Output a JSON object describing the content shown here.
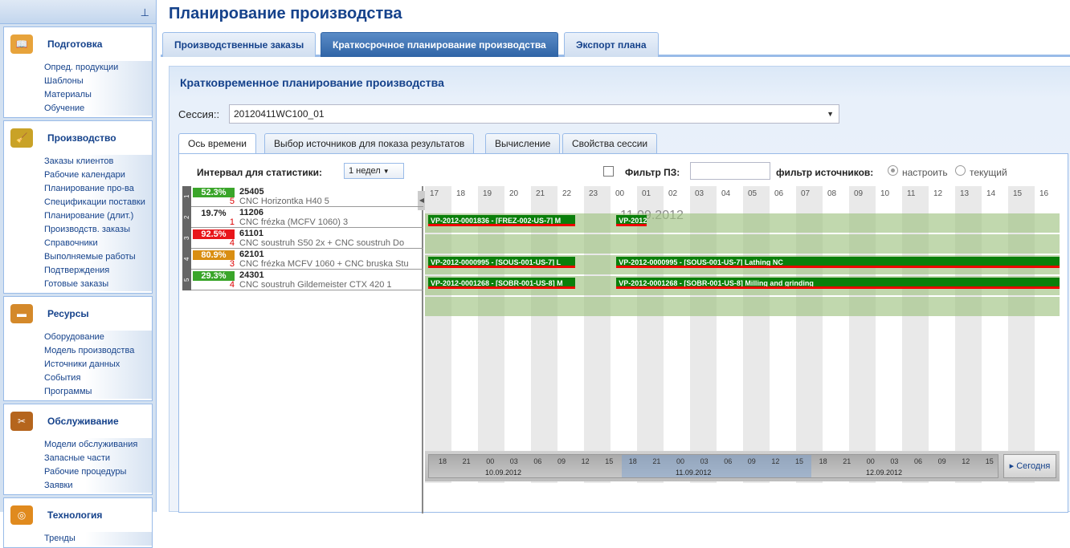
{
  "sidebar": {
    "pin_icon": "pin-icon",
    "sections": [
      {
        "title": "Подготовка",
        "icon": "book-icon",
        "color": "#e7a33b",
        "items": [
          "Опред. продукции",
          "Шаблоны",
          "Материалы",
          "Обучение"
        ]
      },
      {
        "title": "Производство",
        "icon": "broom-icon",
        "color": "#c9a227",
        "items": [
          "Заказы клиентов",
          "Рабочие календари",
          "Планирование про-ва",
          "Спецификации поставки",
          "Планирование (длит.)",
          "Производств. заказы",
          "Справочники",
          "Выполняемые работы",
          "Подтверждения",
          "Готовые заказы"
        ]
      },
      {
        "title": "Ресурсы",
        "icon": "machine-icon",
        "color": "#d4892a",
        "items": [
          "Оборудование",
          "Модель производства",
          "Источники данных",
          "События",
          "Программы"
        ]
      },
      {
        "title": "Обслуживание",
        "icon": "tools-icon",
        "color": "#b5651d",
        "items": [
          "Модели обслуживания",
          "Запасные части",
          "Рабочие процедуры",
          "Заявки"
        ]
      },
      {
        "title": "Технология",
        "icon": "gauge-icon",
        "color": "#e08a1e",
        "items": [
          "Тренды"
        ]
      }
    ]
  },
  "page_title": "Планирование производства",
  "top_tabs": [
    "Производственные заказы",
    "Краткосрочное планирование производства",
    "Экспорт плана"
  ],
  "panel_title": "Кратковременное планирование производства",
  "session": {
    "label": "Сессия::",
    "value": "20120411WC100_01"
  },
  "sub_tabs": [
    "Ось времени",
    "Выбор источников для показа результатов",
    "Вычисление",
    "Свойства сессии"
  ],
  "filters": {
    "interval_label": "Интервал для статистики:",
    "interval_value": "1 недел",
    "fpz_label": "Фильтр ПЗ:",
    "fpz_value": "",
    "source_label": "фильтр источников:",
    "radio_configure": "настроить",
    "radio_current": "текущий"
  },
  "resources": [
    {
      "num": "1",
      "pct": "52.3%",
      "pct_color": "#3aa52a",
      "id": "25405",
      "count": "5",
      "name": "CNC Horizontka H40 5"
    },
    {
      "num": "2",
      "pct": "19.7%",
      "pct_color": "#ffffff",
      "id": "11206",
      "count": "1",
      "name": "CNC frézka (MCFV 1060) 3"
    },
    {
      "num": "3",
      "pct": "92.5%",
      "pct_color": "#e8161b",
      "id": "61101",
      "count": "4",
      "name": "CNC soustruh S50 2x + CNC soustruh Do"
    },
    {
      "num": "4",
      "pct": "80.9%",
      "pct_color": "#d98e12",
      "id": "62101",
      "count": "3",
      "name": "CNC frézka MCFV 1060 + CNC bruska Stu"
    },
    {
      "num": "5",
      "pct": "29.3%",
      "pct_color": "#3aa52a",
      "id": "24301",
      "count": "4",
      "name": "CNC soustruh Gildemeister CTX 420 1"
    }
  ],
  "gantt": {
    "hours": [
      "17",
      "18",
      "19",
      "20",
      "21",
      "22",
      "23",
      "00",
      "01",
      "02",
      "03",
      "04",
      "05",
      "06",
      "07",
      "08",
      "09",
      "10",
      "11",
      "12",
      "13",
      "14",
      "15",
      "16"
    ],
    "date_label": "11.09.2012",
    "bars": [
      {
        "row": 0,
        "start": 0,
        "len": 5.6,
        "label": "VP-2012-0001836 - [FREZ-002-US-7] M"
      },
      {
        "row": 0,
        "start": 7.1,
        "len": 1.2,
        "label": "VP-2012"
      },
      {
        "row": 2,
        "start": 0,
        "len": 5.6,
        "label": "VP-2012-0000995 - [SOUS-001-US-7] L"
      },
      {
        "row": 2,
        "start": 7.1,
        "len": 16.9,
        "label": "VP-2012-0000995 - [SOUS-001-US-7] Lathing NC"
      },
      {
        "row": 3,
        "start": 0,
        "len": 5.6,
        "label": "VP-2012-0001268 - [SOBR-001-US-8] M"
      },
      {
        "row": 3,
        "start": 7.1,
        "len": 16.9,
        "label": "VP-2012-0001268 - [SOBR-001-US-8] Milling and grinding"
      }
    ]
  },
  "navigator": {
    "hours": [
      "18",
      "21",
      "00",
      "03",
      "06",
      "09",
      "12",
      "15",
      "18",
      "21",
      "00",
      "03",
      "06",
      "09",
      "12",
      "15",
      "18",
      "21",
      "00",
      "03",
      "06",
      "09",
      "12",
      "15"
    ],
    "dates": [
      "10.09.2012",
      "11.09.2012",
      "12.09.2012"
    ],
    "today": "Сегодня"
  }
}
